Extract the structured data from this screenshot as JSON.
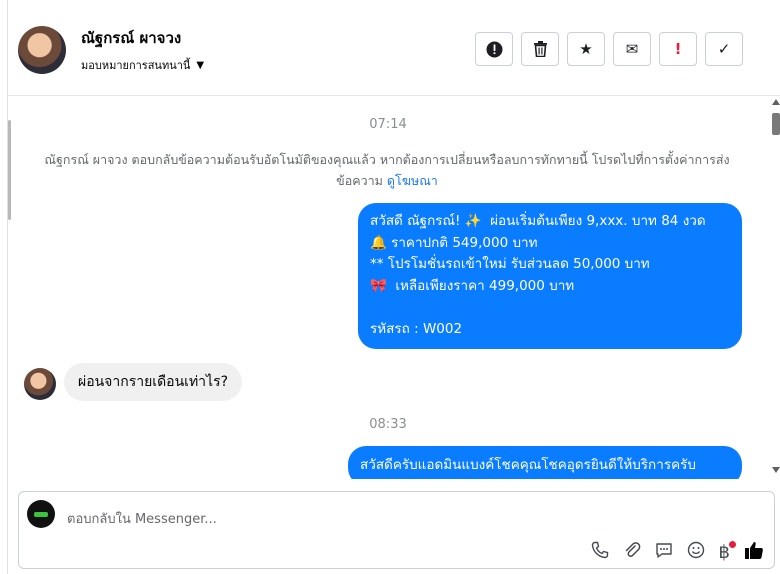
{
  "header": {
    "name": "ณัฐกรณ์ ผาจวง",
    "assign_label": "มอบหมายการสนทนานี้",
    "actions": [
      {
        "icon": "alert-circle-icon",
        "glyph": "!"
      },
      {
        "icon": "trash-icon",
        "glyph": "🗑"
      },
      {
        "icon": "star-icon",
        "glyph": "★"
      },
      {
        "icon": "envelope-icon",
        "glyph": "✉"
      },
      {
        "icon": "exclamation-icon",
        "glyph": "!"
      },
      {
        "icon": "check-icon",
        "glyph": "✓"
      }
    ]
  },
  "conversation": {
    "time_1": "07:14",
    "system_note": "ณัฐกรณ์ ผาจวง ตอบกลับข้อความต้อนรับอัตโนมัติของคุณแล้ว หากต้องการเปลี่ยนหรือลบการทักทายนี้ โปรดไปที่การตั้งค่าการส่งข้อความ",
    "system_link": "ดูโฆษณา",
    "outgoing_1": {
      "line_1": "สวัสดี ณัฐกรณ์! ✨  ผ่อนเริ่มต้นเพียง 9,xxx. บาท 84 งวด",
      "line_2": "🔔 ราคาปกติ 549,000 บาท",
      "line_3": "** โปรโมชั่นรถเข้าใหม่ รับส่วนลด 50,000 บาท",
      "line_4": "🎀  เหลือเพียงราคา 499,000 บาท",
      "line_5": "",
      "line_6": "รหัสรถ : W002"
    },
    "incoming_1": "ผ่อนจากรายเดือนเท่าไร?",
    "time_2": "08:33",
    "outgoing_2": "สวัสดีครับแอดมินแบงค์โชคคุณโชคอุดรยินดีให้บริการครับ"
  },
  "composer": {
    "placeholder": "ตอบกลับใน Messenger...",
    "tools": [
      "phone-icon",
      "paperclip-icon",
      "quick-reply-icon",
      "emoji-icon",
      "baht-icon",
      "thumbs-up-icon"
    ]
  }
}
